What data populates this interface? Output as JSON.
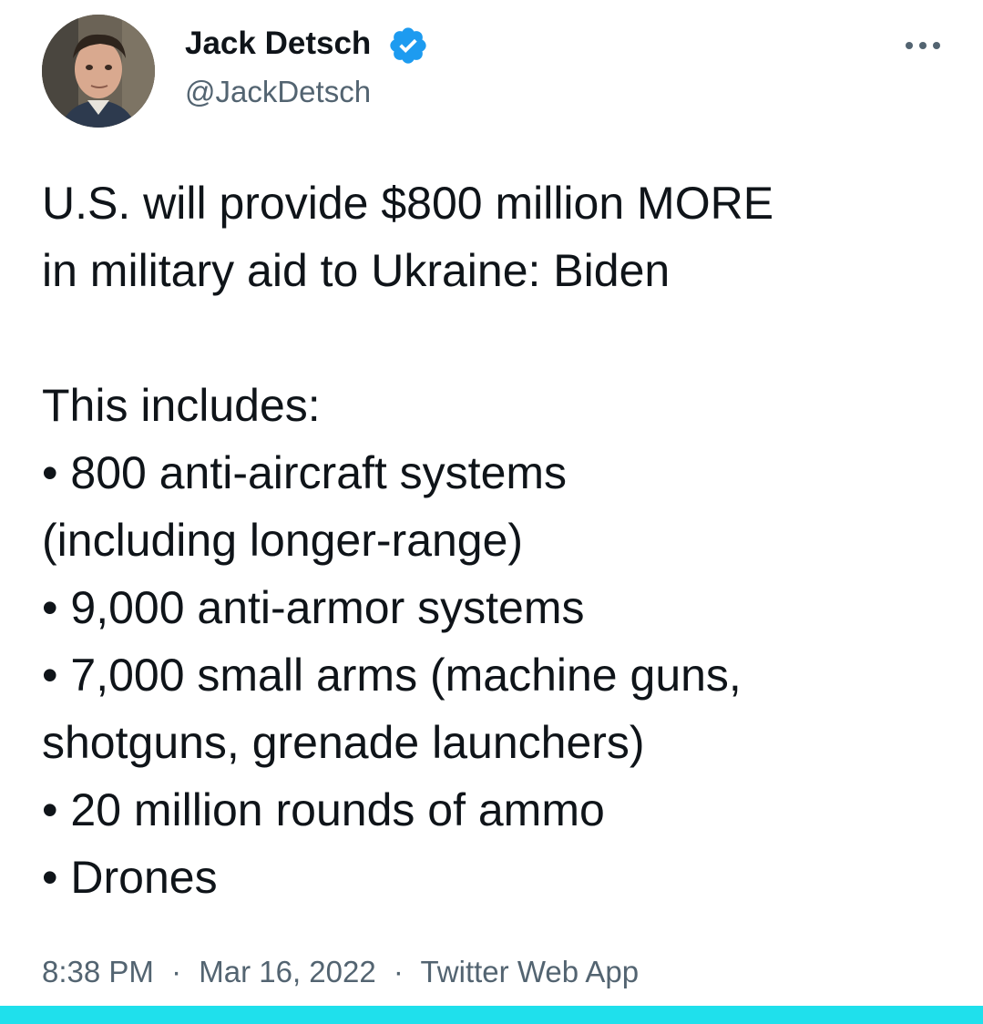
{
  "author": {
    "name": "Jack Detsch",
    "handle": "@JackDetsch",
    "verified": true
  },
  "tweet": {
    "lines": [
      "U.S. will provide $800 million MORE",
      "in military aid to Ukraine: Biden",
      "",
      "This includes:",
      "• 800 anti-aircraft systems",
      "(including longer-range)",
      "• 9,000 anti-armor systems",
      "• 7,000 small arms (machine guns,",
      "shotguns, grenade launchers)",
      "• 20 million rounds of ammo",
      "• Drones"
    ]
  },
  "meta": {
    "time": "8:38 PM",
    "separator": "·",
    "date": "Mar 16, 2022",
    "source": "Twitter Web App"
  },
  "colors": {
    "text": "#0f1419",
    "secondary": "#536471",
    "verified": "#1d9bf0",
    "bottom_bar": "#1fe0ec"
  },
  "icons": {
    "verified": "verified-badge-icon",
    "more": "more-options-icon"
  }
}
